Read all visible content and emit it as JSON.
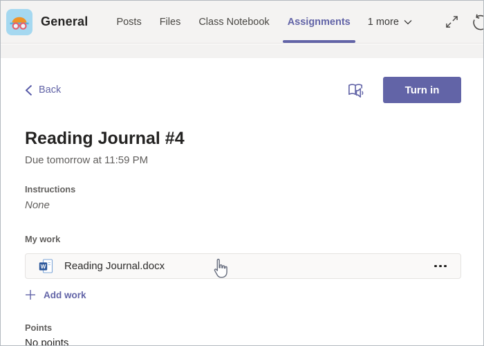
{
  "header": {
    "team_name": "General",
    "tabs": [
      {
        "label": "Posts"
      },
      {
        "label": "Files"
      },
      {
        "label": "Class Notebook"
      },
      {
        "label": "Assignments"
      }
    ],
    "more_tabs_label": "1 more"
  },
  "toolbar": {
    "back_label": "Back",
    "turn_in_label": "Turn in"
  },
  "assignment": {
    "title": "Reading Journal #4",
    "due": "Due tomorrow at 11:59 PM",
    "instructions_label": "Instructions",
    "instructions_value": "None",
    "my_work_label": "My work",
    "attachment": {
      "filename": "Reading Journal.docx"
    },
    "add_work_label": "Add work",
    "points_label": "Points",
    "points_value": "No points"
  },
  "icons": {
    "team_avatar": "swimmer-avatar",
    "header_right": [
      "expand-icon",
      "refresh-icon"
    ],
    "more_tabs": "chevron-down-icon",
    "back": "chevron-left-icon",
    "reader": "immersive-reader-icon",
    "file": "word-file-icon",
    "more_options": "ellipsis-icon",
    "add": "plus-icon",
    "pointer": "hand-cursor"
  },
  "colors": {
    "accent": "#6264a7",
    "word_blue": "#2b579a",
    "header_bg": "#f4f3f2",
    "card_bg": "#faf9f8",
    "avatar_bg": "#a5d8f0",
    "avatar_cap": "#ef9226",
    "avatar_goggles": "#e4606d"
  }
}
